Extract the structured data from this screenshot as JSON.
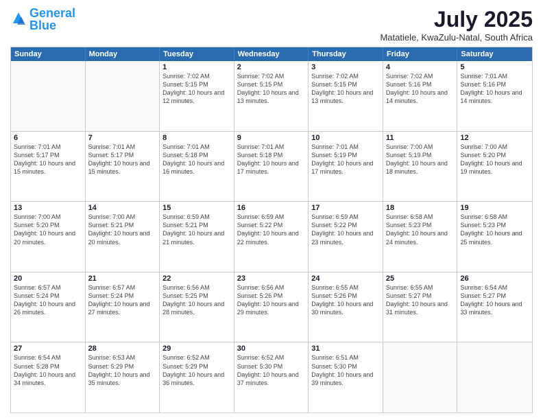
{
  "header": {
    "logo_general": "General",
    "logo_blue": "Blue",
    "title": "July 2025",
    "subtitle": "Matatiele, KwaZulu-Natal, South Africa"
  },
  "calendar": {
    "days_of_week": [
      "Sunday",
      "Monday",
      "Tuesday",
      "Wednesday",
      "Thursday",
      "Friday",
      "Saturday"
    ],
    "rows": [
      [
        {
          "day": "",
          "detail": "",
          "empty": true
        },
        {
          "day": "",
          "detail": "",
          "empty": true
        },
        {
          "day": "1",
          "detail": "Sunrise: 7:02 AM\nSunset: 5:15 PM\nDaylight: 10 hours\nand 12 minutes."
        },
        {
          "day": "2",
          "detail": "Sunrise: 7:02 AM\nSunset: 5:15 PM\nDaylight: 10 hours\nand 13 minutes."
        },
        {
          "day": "3",
          "detail": "Sunrise: 7:02 AM\nSunset: 5:15 PM\nDaylight: 10 hours\nand 13 minutes."
        },
        {
          "day": "4",
          "detail": "Sunrise: 7:02 AM\nSunset: 5:16 PM\nDaylight: 10 hours\nand 14 minutes."
        },
        {
          "day": "5",
          "detail": "Sunrise: 7:01 AM\nSunset: 5:16 PM\nDaylight: 10 hours\nand 14 minutes."
        }
      ],
      [
        {
          "day": "6",
          "detail": "Sunrise: 7:01 AM\nSunset: 5:17 PM\nDaylight: 10 hours\nand 15 minutes."
        },
        {
          "day": "7",
          "detail": "Sunrise: 7:01 AM\nSunset: 5:17 PM\nDaylight: 10 hours\nand 15 minutes."
        },
        {
          "day": "8",
          "detail": "Sunrise: 7:01 AM\nSunset: 5:18 PM\nDaylight: 10 hours\nand 16 minutes."
        },
        {
          "day": "9",
          "detail": "Sunrise: 7:01 AM\nSunset: 5:18 PM\nDaylight: 10 hours\nand 17 minutes."
        },
        {
          "day": "10",
          "detail": "Sunrise: 7:01 AM\nSunset: 5:19 PM\nDaylight: 10 hours\nand 17 minutes."
        },
        {
          "day": "11",
          "detail": "Sunrise: 7:00 AM\nSunset: 5:19 PM\nDaylight: 10 hours\nand 18 minutes."
        },
        {
          "day": "12",
          "detail": "Sunrise: 7:00 AM\nSunset: 5:20 PM\nDaylight: 10 hours\nand 19 minutes."
        }
      ],
      [
        {
          "day": "13",
          "detail": "Sunrise: 7:00 AM\nSunset: 5:20 PM\nDaylight: 10 hours\nand 20 minutes."
        },
        {
          "day": "14",
          "detail": "Sunrise: 7:00 AM\nSunset: 5:21 PM\nDaylight: 10 hours\nand 20 minutes."
        },
        {
          "day": "15",
          "detail": "Sunrise: 6:59 AM\nSunset: 5:21 PM\nDaylight: 10 hours\nand 21 minutes."
        },
        {
          "day": "16",
          "detail": "Sunrise: 6:59 AM\nSunset: 5:22 PM\nDaylight: 10 hours\nand 22 minutes."
        },
        {
          "day": "17",
          "detail": "Sunrise: 6:59 AM\nSunset: 5:22 PM\nDaylight: 10 hours\nand 23 minutes."
        },
        {
          "day": "18",
          "detail": "Sunrise: 6:58 AM\nSunset: 5:23 PM\nDaylight: 10 hours\nand 24 minutes."
        },
        {
          "day": "19",
          "detail": "Sunrise: 6:58 AM\nSunset: 5:23 PM\nDaylight: 10 hours\nand 25 minutes."
        }
      ],
      [
        {
          "day": "20",
          "detail": "Sunrise: 6:57 AM\nSunset: 5:24 PM\nDaylight: 10 hours\nand 26 minutes."
        },
        {
          "day": "21",
          "detail": "Sunrise: 6:57 AM\nSunset: 5:24 PM\nDaylight: 10 hours\nand 27 minutes."
        },
        {
          "day": "22",
          "detail": "Sunrise: 6:56 AM\nSunset: 5:25 PM\nDaylight: 10 hours\nand 28 minutes."
        },
        {
          "day": "23",
          "detail": "Sunrise: 6:56 AM\nSunset: 5:26 PM\nDaylight: 10 hours\nand 29 minutes."
        },
        {
          "day": "24",
          "detail": "Sunrise: 6:55 AM\nSunset: 5:26 PM\nDaylight: 10 hours\nand 30 minutes."
        },
        {
          "day": "25",
          "detail": "Sunrise: 6:55 AM\nSunset: 5:27 PM\nDaylight: 10 hours\nand 31 minutes."
        },
        {
          "day": "26",
          "detail": "Sunrise: 6:54 AM\nSunset: 5:27 PM\nDaylight: 10 hours\nand 33 minutes."
        }
      ],
      [
        {
          "day": "27",
          "detail": "Sunrise: 6:54 AM\nSunset: 5:28 PM\nDaylight: 10 hours\nand 34 minutes."
        },
        {
          "day": "28",
          "detail": "Sunrise: 6:53 AM\nSunset: 5:29 PM\nDaylight: 10 hours\nand 35 minutes."
        },
        {
          "day": "29",
          "detail": "Sunrise: 6:52 AM\nSunset: 5:29 PM\nDaylight: 10 hours\nand 36 minutes."
        },
        {
          "day": "30",
          "detail": "Sunrise: 6:52 AM\nSunset: 5:30 PM\nDaylight: 10 hours\nand 37 minutes."
        },
        {
          "day": "31",
          "detail": "Sunrise: 6:51 AM\nSunset: 5:30 PM\nDaylight: 10 hours\nand 39 minutes."
        },
        {
          "day": "",
          "detail": "",
          "empty": true
        },
        {
          "day": "",
          "detail": "",
          "empty": true
        }
      ]
    ]
  }
}
